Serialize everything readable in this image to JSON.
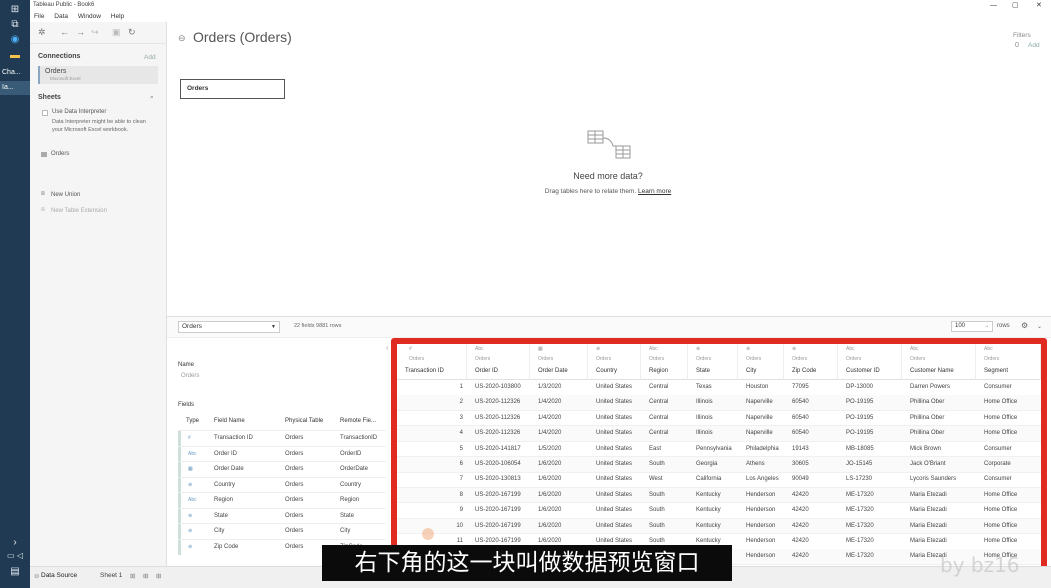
{
  "window": {
    "title": "Tableau Public - Book6",
    "controls": [
      "—",
      "▢",
      "✕"
    ]
  },
  "menu": [
    "File",
    "Data",
    "Window",
    "Help"
  ],
  "taskbar": {
    "apps": [
      "Cha...",
      "Ia..."
    ]
  },
  "left_panel": {
    "connections_label": "Connections",
    "add_label": "Add",
    "connection": {
      "name": "Orders",
      "type": "Microsoft Excel"
    },
    "sheets_label": "Sheets",
    "use_interpreter": "Use Data Interpreter",
    "interpreter_note": "Data Interpreter might be able to clean your Microsoft Excel workbook.",
    "sheet": "Orders",
    "new_union": "New Union",
    "new_extension": "New Table Extension"
  },
  "canvas": {
    "title": "Orders (Orders)",
    "filters_label": "Filters",
    "filters_count": "0",
    "filters_add": "Add",
    "table_box": "Orders",
    "need_more": "Need more data?",
    "drag_text": "Drag tables here to relate them.",
    "learn_more": "Learn more"
  },
  "grid_toolbar": {
    "table_select": "Orders",
    "fields_rows": "22 fields 9881 rows",
    "rows_value": "100",
    "rows_label": "rows"
  },
  "metadata": {
    "name_label": "Name",
    "name_value": "Orders",
    "fields_label": "Fields",
    "headers": [
      "Type",
      "Field Name",
      "Physical Table",
      "Remote Fie..."
    ],
    "rows": [
      {
        "type": "#",
        "field": "Transaction ID",
        "table": "Orders",
        "remote": "TransactionID"
      },
      {
        "type": "Abc",
        "field": "Order ID",
        "table": "Orders",
        "remote": "OrderID"
      },
      {
        "type": "▦",
        "field": "Order Date",
        "table": "Orders",
        "remote": "OrderDate"
      },
      {
        "type": "⊕",
        "field": "Country",
        "table": "Orders",
        "remote": "Country"
      },
      {
        "type": "Abc",
        "field": "Region",
        "table": "Orders",
        "remote": "Region"
      },
      {
        "type": "⊕",
        "field": "State",
        "table": "Orders",
        "remote": "State"
      },
      {
        "type": "⊕",
        "field": "City",
        "table": "Orders",
        "remote": "City"
      },
      {
        "type": "⊕",
        "field": "Zip Code",
        "table": "Orders",
        "remote": "ZipCode"
      }
    ]
  },
  "data_grid": {
    "columns": [
      {
        "type": "#",
        "source": "Orders",
        "name": "Transaction ID"
      },
      {
        "type": "Abc",
        "source": "Orders",
        "name": "Order ID"
      },
      {
        "type": "▦",
        "source": "Orders",
        "name": "Order Date"
      },
      {
        "type": "⊕",
        "source": "Orders",
        "name": "Country"
      },
      {
        "type": "Abc",
        "source": "Orders",
        "name": "Region"
      },
      {
        "type": "⊕",
        "source": "Orders",
        "name": "State"
      },
      {
        "type": "⊕",
        "source": "Orders",
        "name": "City"
      },
      {
        "type": "⊕",
        "source": "Orders",
        "name": "Zip Code"
      },
      {
        "type": "Abc",
        "source": "Orders",
        "name": "Customer ID"
      },
      {
        "type": "Abc",
        "source": "Orders",
        "name": "Customer Name"
      },
      {
        "type": "Abc",
        "source": "Orders",
        "name": "Segment"
      }
    ],
    "rows": [
      [
        "1",
        "US-2020-103800",
        "1/3/2020",
        "United States",
        "Central",
        "Texas",
        "Houston",
        "77095",
        "DP-13000",
        "Darren Powers",
        "Consumer"
      ],
      [
        "2",
        "US-2020-112326",
        "1/4/2020",
        "United States",
        "Central",
        "Illinois",
        "Naperville",
        "60540",
        "PO-19195",
        "Phillina Ober",
        "Home Office"
      ],
      [
        "3",
        "US-2020-112326",
        "1/4/2020",
        "United States",
        "Central",
        "Illinois",
        "Naperville",
        "60540",
        "PO-19195",
        "Phillina Ober",
        "Home Office"
      ],
      [
        "4",
        "US-2020-112326",
        "1/4/2020",
        "United States",
        "Central",
        "Illinois",
        "Naperville",
        "60540",
        "PO-19195",
        "Phillina Ober",
        "Home Office"
      ],
      [
        "5",
        "US-2020-141817",
        "1/5/2020",
        "United States",
        "East",
        "Pennsylvania",
        "Philadelphia",
        "19143",
        "MB-18085",
        "Mick Brown",
        "Consumer"
      ],
      [
        "6",
        "US-2020-106054",
        "1/6/2020",
        "United States",
        "South",
        "Georgia",
        "Athens",
        "30605",
        "JO-15145",
        "Jack O'Briant",
        "Corporate"
      ],
      [
        "7",
        "US-2020-130813",
        "1/6/2020",
        "United States",
        "West",
        "California",
        "Los Angeles",
        "90049",
        "LS-17230",
        "Lycoris Saunders",
        "Consumer"
      ],
      [
        "8",
        "US-2020-167199",
        "1/6/2020",
        "United States",
        "South",
        "Kentucky",
        "Henderson",
        "42420",
        "ME-17320",
        "Maria Etezadi",
        "Home Office"
      ],
      [
        "9",
        "US-2020-167199",
        "1/6/2020",
        "United States",
        "South",
        "Kentucky",
        "Henderson",
        "42420",
        "ME-17320",
        "Maria Etezadi",
        "Home Office"
      ],
      [
        "10",
        "US-2020-167199",
        "1/6/2020",
        "United States",
        "South",
        "Kentucky",
        "Henderson",
        "42420",
        "ME-17320",
        "Maria Etezadi",
        "Home Office"
      ],
      [
        "11",
        "US-2020-167199",
        "1/6/2020",
        "United States",
        "South",
        "Kentucky",
        "Henderson",
        "42420",
        "ME-17320",
        "Maria Etezadi",
        "Home Office"
      ],
      [
        "12",
        "US-2020-167199",
        "1/6/2020",
        "United States",
        "South",
        "Kentucky",
        "Henderson",
        "42420",
        "ME-17320",
        "Maria Etezadi",
        "Home Office"
      ]
    ]
  },
  "tabs": {
    "data_source": "Data Source",
    "sheet1": "Sheet 1"
  },
  "overlay": {
    "subtitle": "右下角的这一块叫做数据预览窗口",
    "watermark": "by bz16"
  },
  "colors": {
    "highlight_border": "#e02b20",
    "taskbar": "#1f3a52"
  }
}
